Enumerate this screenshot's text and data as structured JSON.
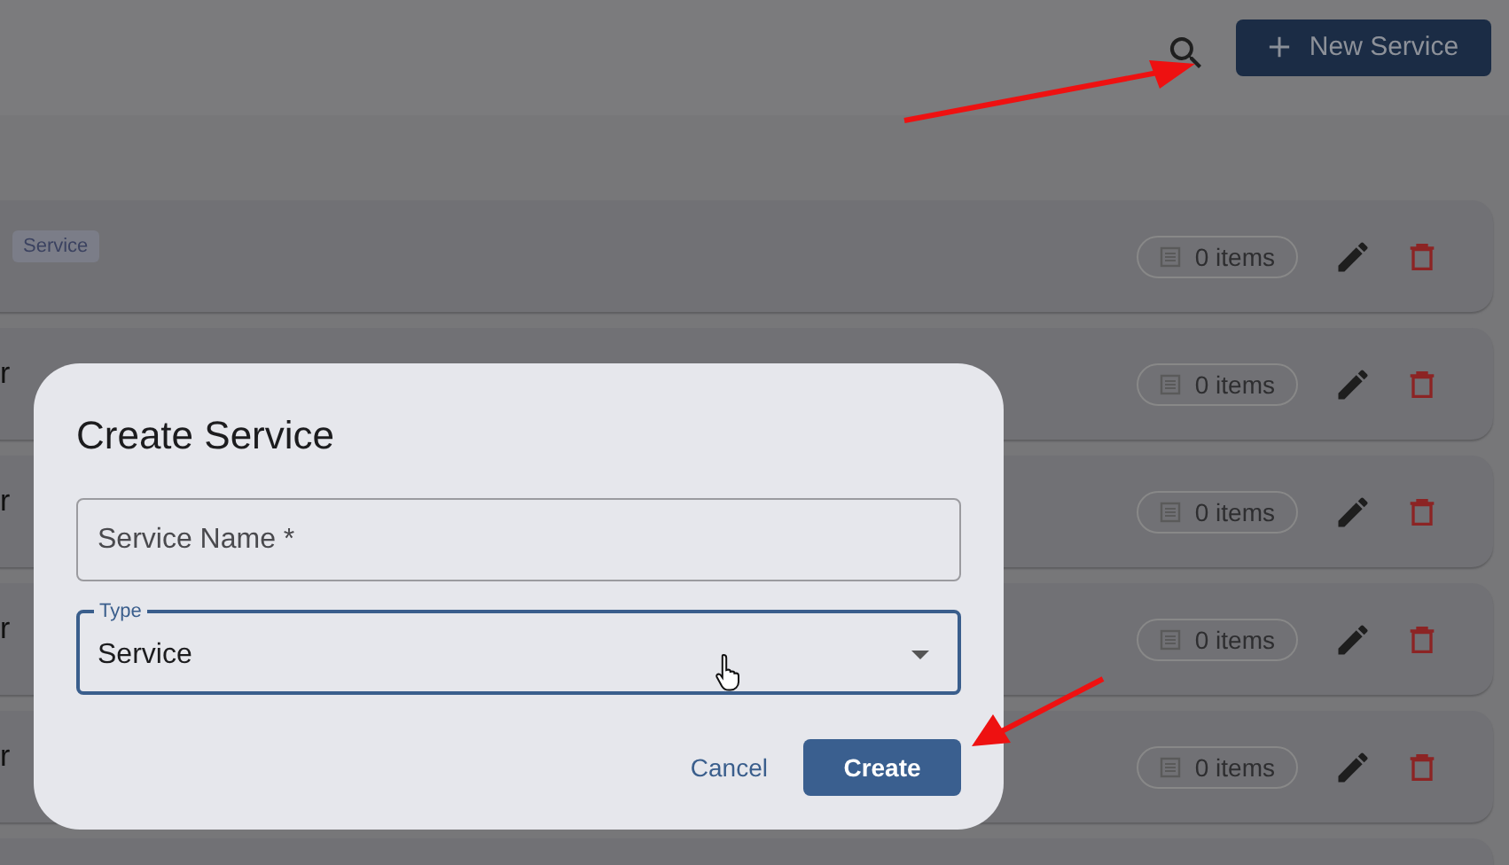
{
  "header": {
    "new_button": "New Service"
  },
  "rows": [
    {
      "tag": "Service",
      "count": "0 items"
    },
    {
      "title": "r",
      "count": "0 items"
    },
    {
      "title": "r",
      "count": "0 items"
    },
    {
      "title": "r",
      "count": "0 items"
    },
    {
      "title": "r",
      "count": "0 items"
    }
  ],
  "dialog": {
    "title": "Create Service",
    "name_field": {
      "placeholder": "Service Name *"
    },
    "type_field": {
      "label": "Type",
      "value": "Service"
    },
    "buttons": [
      {
        "label": "Cancel",
        "kind": "text"
      },
      {
        "label": "Create",
        "kind": "primary"
      }
    ]
  }
}
